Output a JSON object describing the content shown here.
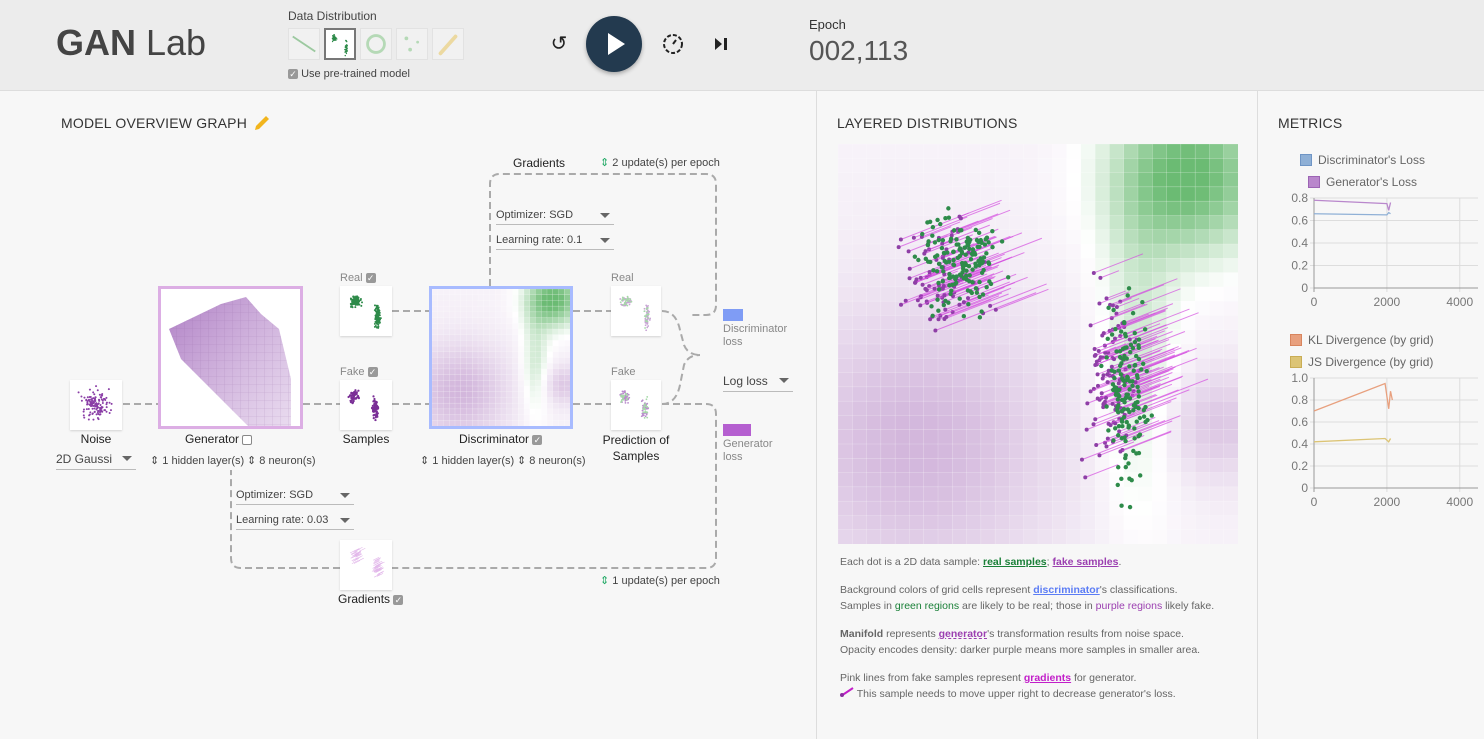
{
  "header": {
    "title_bold": "GAN",
    "title_rest": "Lab",
    "data_distribution_label": "Data Distribution",
    "distributions": [
      "line",
      "two-clusters",
      "ring",
      "three-dots",
      "drawing"
    ],
    "selected_distribution": 1,
    "pretrained_label": "Use pre-trained model",
    "pretrained_checked": true,
    "epoch_label": "Epoch",
    "epoch_value": "002,113"
  },
  "graph": {
    "title": "MODEL OVERVIEW GRAPH",
    "noise_label": "Noise",
    "noise_dropdown": "2D Gaussi",
    "generator_label": "Generator",
    "gen_hidden": "1 hidden layer(s)",
    "gen_neurons": "8 neuron(s)",
    "real_label": "Real",
    "fake_label": "Fake",
    "samples_label": "Samples",
    "discriminator_label": "Discriminator",
    "disc_hidden": "1 hidden layer(s)",
    "disc_neurons": "8 neuron(s)",
    "pred_real_label": "Real",
    "pred_fake_label": "Fake",
    "prediction_label_1": "Prediction of",
    "prediction_label_2": "Samples",
    "disc_loss_1": "Discriminator",
    "disc_loss_2": "loss",
    "gen_loss_1": "Generator",
    "gen_loss_2": "loss",
    "loss_dropdown": "Log loss",
    "top_gradients_label": "Gradients",
    "disc_updates": "2 update(s) per epoch",
    "disc_optimizer_label": "Optimizer:",
    "disc_optimizer": "SGD",
    "disc_lr_label": "Learning rate:",
    "disc_lr": "0.1",
    "gen_optimizer_label": "Optimizer:",
    "gen_optimizer": "SGD",
    "gen_lr_label": "Learning rate:",
    "gen_lr": "0.03",
    "bottom_gradients_label": "Gradients",
    "gen_updates": "1 update(s) per epoch",
    "colors": {
      "disc": "#7f9cf5",
      "gen": "#b55fd0"
    }
  },
  "layered": {
    "title": "LAYERED DISTRIBUTIONS",
    "d1_pre": "Each dot is a 2D data sample: ",
    "d1_real": "real samples",
    "d1_sep": "; ",
    "d1_fake": "fake samples",
    "d1_end": ".",
    "d2_pre": "Background colors of grid cells represent ",
    "d2_link": "discriminator",
    "d2_post": "'s classifications.",
    "d3_pre": "Samples in ",
    "d3_green": "green regions",
    "d3_mid": " are likely to be real; those in ",
    "d3_purple": "purple regions",
    "d3_post": " likely fake.",
    "d4_bold": "Manifold",
    "d4_pre": " represents ",
    "d4_link": "generator",
    "d4_post": "'s transformation results from noise space.",
    "d5": "Opacity encodes density: darker purple means more samples in smaller area.",
    "d6_pre": "Pink lines from fake samples represent ",
    "d6_link": "gradients",
    "d6_post": " for generator.",
    "d7": "This sample needs to move upper right to decrease generator's loss."
  },
  "metrics": {
    "title": "METRICS",
    "chart_data": [
      {
        "type": "line",
        "legend": [
          "Discriminator's Loss",
          "Generator's Loss"
        ],
        "colors": [
          "#8fb0d6",
          "#b987cc"
        ],
        "xlim": [
          0,
          4500
        ],
        "ylim": [
          0,
          0.8
        ],
        "xticks": [
          "0",
          "2000",
          "4000"
        ],
        "yticks": [
          "0",
          "0.2",
          "0.4",
          "0.6",
          "0.8"
        ],
        "series": [
          {
            "name": "Discriminator's Loss",
            "x": [
              0,
              2000,
              2050,
              2100
            ],
            "y": [
              0.66,
              0.65,
              0.67,
              0.66
            ]
          },
          {
            "name": "Generator's Loss",
            "x": [
              0,
              2000,
              2050,
              2100
            ],
            "y": [
              0.78,
              0.75,
              0.69,
              0.76
            ]
          }
        ]
      },
      {
        "type": "line",
        "legend": [
          "KL Divergence (by grid)",
          "JS Divergence (by grid)"
        ],
        "colors": [
          "#e8a07e",
          "#dcc475"
        ],
        "xlim": [
          0,
          4500
        ],
        "ylim": [
          0,
          1.0
        ],
        "xticks": [
          "0",
          "2000",
          "4000"
        ],
        "yticks": [
          "0",
          "0.2",
          "0.4",
          "0.6",
          "0.8",
          "1.0"
        ],
        "series": [
          {
            "name": "KL Divergence (by grid)",
            "x": [
              0,
              1950,
              2050,
              2100,
              2150
            ],
            "y": [
              0.7,
              0.95,
              0.72,
              0.88,
              0.8
            ]
          },
          {
            "name": "JS Divergence (by grid)",
            "x": [
              0,
              1950,
              2050,
              2100
            ],
            "y": [
              0.42,
              0.45,
              0.42,
              0.45
            ]
          }
        ]
      }
    ]
  }
}
